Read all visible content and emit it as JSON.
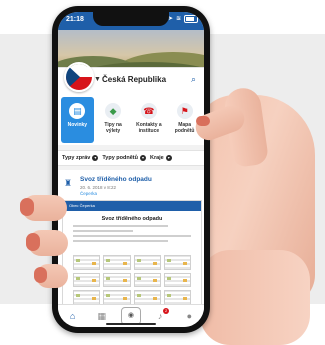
{
  "status_bar": {
    "time": "21:18"
  },
  "location": {
    "country": "Česká Republika"
  },
  "tiles": [
    {
      "label": "Novinky",
      "icon": "news-icon",
      "active": true
    },
    {
      "label": "Tipy na výlety",
      "icon": "bag-icon",
      "active": false
    },
    {
      "label": "Kontakty a instituce",
      "icon": "contacts-icon",
      "active": false
    },
    {
      "label": "Mapa podnětů",
      "icon": "map-pin-icon",
      "active": false
    }
  ],
  "filters": [
    {
      "label": "Typy zpráv"
    },
    {
      "label": "Typy podnětů"
    },
    {
      "label": "Kraje"
    }
  ],
  "post": {
    "title": "Svoz tříděného odpadu",
    "date": "20. 6. 2018 v 8:22",
    "location": "Čeperka",
    "doc_header": "Obec Čeperka",
    "doc_title": "Svoz tříděného odpadu"
  },
  "tabbar": {
    "notification_count": "2"
  },
  "colors": {
    "primary": "#1f5fa9",
    "accent": "#2a8de0",
    "flag_red": "#d7141a",
    "flag_blue": "#11457e"
  }
}
